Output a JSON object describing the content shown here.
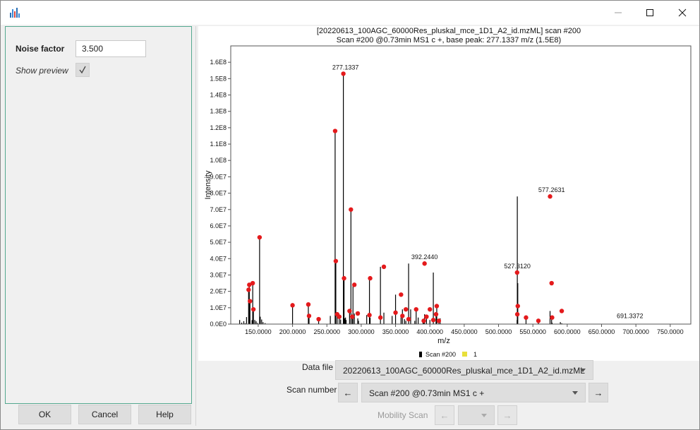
{
  "window": {
    "colors": {
      "accent_border": "#54a88f",
      "peak_marker": "#e41a1c"
    }
  },
  "params": {
    "noise_factor_label": "Noise factor",
    "noise_factor_value": "3.500",
    "show_preview_label": "Show preview",
    "show_preview_checked": true
  },
  "buttons": {
    "ok": "OK",
    "cancel": "Cancel",
    "help": "Help"
  },
  "plot": {
    "title_line1": "[20220613_100AGC_60000Res_pluskal_mce_1D1_A2_id.mzML] scan #200",
    "title_line2": "Scan #200 @0.73min MS1 c +, base peak: 277.1337 m/z (1.5E8)",
    "legend": [
      {
        "name": "Scan #200",
        "color": "#000000"
      },
      {
        "name": "1",
        "color": "#e8e03a"
      }
    ]
  },
  "controls": {
    "data_file_label": "Data file",
    "data_file_value": "20220613_100AGC_60000Res_pluskal_mce_1D1_A2_id.mzML",
    "scan_number_label": "Scan number",
    "scan_value": "Scan #200 @0.73min MS1 c +",
    "prev_arrow": "←",
    "next_arrow": "→",
    "mobility_label": "Mobility Scan",
    "mobility_value": ""
  },
  "chart_data": {
    "type": "bar",
    "xlabel": "m/z",
    "ylabel": "Intensity",
    "xlim": [
      110,
      780
    ],
    "ylim": [
      0,
      170000000
    ],
    "x_ticks": [
      150,
      200,
      250,
      300,
      350,
      400,
      450,
      500,
      550,
      600,
      650,
      700,
      750
    ],
    "x_tick_labels": [
      "150.0000",
      "200.0000",
      "250.0000",
      "300.0000",
      "350.0000",
      "400.0000",
      "450.0000",
      "500.0000",
      "550.0000",
      "600.0000",
      "650.0000",
      "700.0000",
      "750.0000"
    ],
    "y_ticks": [
      0,
      10000000,
      20000000,
      30000000,
      40000000,
      50000000,
      60000000,
      70000000,
      80000000,
      90000000,
      100000000,
      110000000,
      120000000,
      130000000,
      140000000,
      150000000,
      160000000
    ],
    "y_tick_labels": [
      "0.0E0",
      "1.0E7",
      "2.0E7",
      "3.0E7",
      "4.0E7",
      "5.0E7",
      "6.0E7",
      "7.0E7",
      "8.0E7",
      "9.0E7",
      "1.0E8",
      "1.1E8",
      "1.2E8",
      "1.3E8",
      "1.4E8",
      "1.5E8",
      "1.6E8"
    ],
    "series": [
      {
        "name": "Scan #200",
        "x": [
          123,
          126,
          129,
          131,
          133,
          136,
          137,
          138,
          141,
          142,
          143,
          145,
          147,
          149,
          152,
          153,
          155,
          157,
          160,
          200,
          223,
          224,
          238,
          255,
          262,
          263,
          265,
          268,
          270,
          274,
          275,
          276,
          277.1337,
          278,
          283,
          285,
          287,
          288,
          290,
          295,
          296,
          308,
          312,
          313,
          328,
          333,
          345,
          350,
          358,
          360,
          363,
          365,
          369,
          372,
          378,
          380,
          383,
          390,
          391,
          392.244,
          395,
          400,
          405,
          409,
          410,
          413,
          415,
          527,
          527.312,
          528,
          540,
          558,
          575,
          577.2631,
          578,
          590,
          592
        ],
        "values": [
          2500000,
          900000,
          1800000,
          500000,
          4300000,
          21000000,
          24000000,
          14000000,
          2400000,
          25000000,
          9000000,
          2500000,
          1700000,
          700000,
          53000000,
          4500000,
          2800000,
          1200000,
          600000,
          11500000,
          12000000,
          5000000,
          3000000,
          5000000,
          118000000,
          38500000,
          6000000,
          4500000,
          2800000,
          153000000,
          28000000,
          3500000,
          4000000,
          2500000,
          8000000,
          70000000,
          4500000,
          24000000,
          6500000,
          3500000,
          2000000,
          5500000,
          28000000,
          4000000,
          35000000,
          7000000,
          5000000,
          18000000,
          5000000,
          9000000,
          3000000,
          2000000,
          37000000,
          9000000,
          2000000,
          9000000,
          4000000,
          2500000,
          2000000,
          6000000,
          4500000,
          2500000,
          31500000,
          6000000,
          11000000,
          2000000,
          3500000,
          2500000,
          78000000,
          25000000,
          4000000,
          2000000,
          8000000,
          3000000,
          800000,
          1200000,
          500000
        ]
      }
    ],
    "markers": {
      "x": [
        136,
        137,
        138,
        142,
        143,
        152,
        200,
        223,
        224,
        238,
        262,
        263,
        265,
        268,
        274,
        275,
        283,
        285,
        287,
        290,
        295,
        312,
        313,
        328,
        333,
        350,
        358,
        360,
        365,
        369,
        380,
        391,
        392.244,
        395,
        400,
        405,
        409,
        410,
        413,
        527,
        527.312,
        528,
        540,
        558,
        575,
        577.2631,
        578,
        592
      ],
      "y": [
        21000000,
        24000000,
        14000000,
        25000000,
        9000000,
        53000000,
        11500000,
        12000000,
        5000000,
        3000000,
        118000000,
        38500000,
        6000000,
        4500000,
        153000000,
        28000000,
        8000000,
        70000000,
        4500000,
        24000000,
        6500000,
        5500000,
        28000000,
        4000000,
        35000000,
        7000000,
        18000000,
        5000000,
        9000000,
        3000000,
        9000000,
        2000000,
        37000000,
        4500000,
        9000000,
        2500000,
        6000000,
        11000000,
        2000000,
        31500000,
        6000000,
        11000000,
        4000000,
        2000000,
        78000000,
        25000000,
        4000000,
        8000000
      ]
    },
    "annotations": [
      {
        "x": 277.1337,
        "y": 153000000,
        "text": "277.1337"
      },
      {
        "x": 392.244,
        "y": 37000000,
        "text": "392.2440"
      },
      {
        "x": 527.312,
        "y": 31500000,
        "text": "527.3120"
      },
      {
        "x": 577.2631,
        "y": 78000000,
        "text": "577.2631"
      },
      {
        "x": 691.3372,
        "y": 1000000,
        "text": "691.3372"
      }
    ]
  }
}
